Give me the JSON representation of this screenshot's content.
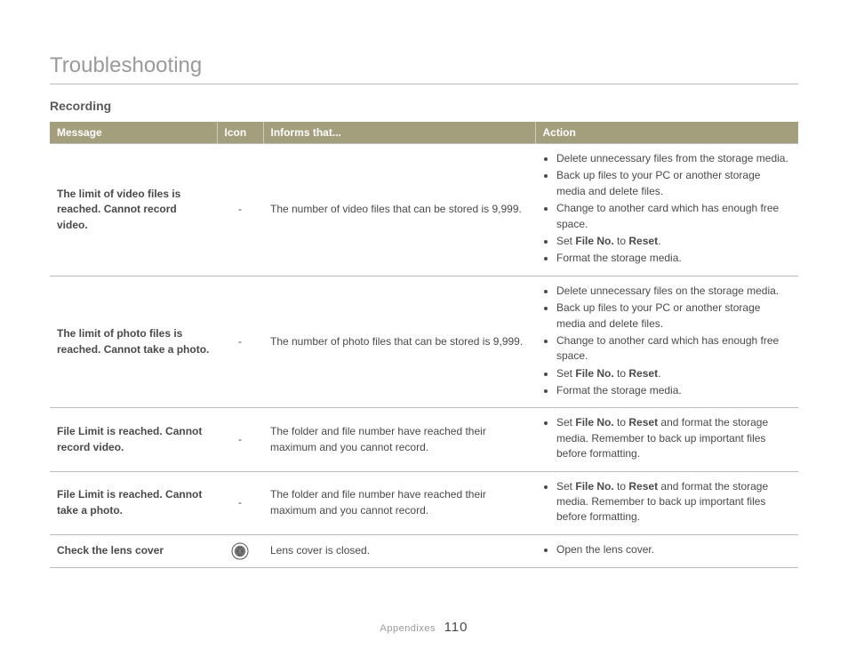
{
  "title": "Troubleshooting",
  "section": "Recording",
  "headers": {
    "message": "Message",
    "icon": "Icon",
    "informs": "Informs that...",
    "action": "Action"
  },
  "rows": [
    {
      "message": "The limit of video files is reached. Cannot record video.",
      "icon": "-",
      "informs": "The number of video files that can be stored is 9,999.",
      "action_type": "list_reset",
      "action_items": [
        "Delete unnecessary files from the storage media.",
        "Back up files to your PC or another storage media and delete files.",
        "Change to another card which has enough free space.",
        "__SET_RESET__",
        "Format the storage media."
      ]
    },
    {
      "message": "The limit of photo files is reached. Cannot take a photo.",
      "icon": "-",
      "informs": "The number of photo files that can be stored is 9,999.",
      "action_type": "list_reset",
      "action_items": [
        "Delete unnecessary files on the storage media.",
        "Back up files to your PC or another storage media and delete files.",
        "Change to another card which has enough free space.",
        "__SET_RESET__",
        "Format the storage media."
      ]
    },
    {
      "message": "File Limit is reached. Cannot record video.",
      "icon": "-",
      "informs": "The folder and file number have reached their maximum and you cannot record.",
      "action_type": "list_format",
      "action_tail": " and format the storage media. Remember to back up important files before formatting."
    },
    {
      "message": "File Limit is reached. Cannot take a photo.",
      "icon": "-",
      "informs": "The folder and file number have reached their maximum and you cannot record.",
      "action_type": "list_format",
      "action_tail": " and format the storage media. Remember to back up important files before formatting."
    },
    {
      "message": "Check the lens cover",
      "icon": "__LENS_ICON__",
      "informs": "Lens cover is closed.",
      "action_type": "list_plain",
      "action_items": [
        "Open the lens cover."
      ]
    }
  ],
  "bold_terms": {
    "set": "Set ",
    "file_no": "File No.",
    "to": " to ",
    "reset": "Reset",
    "period": "."
  },
  "footer": {
    "section": "Appendixes",
    "page": "110"
  }
}
